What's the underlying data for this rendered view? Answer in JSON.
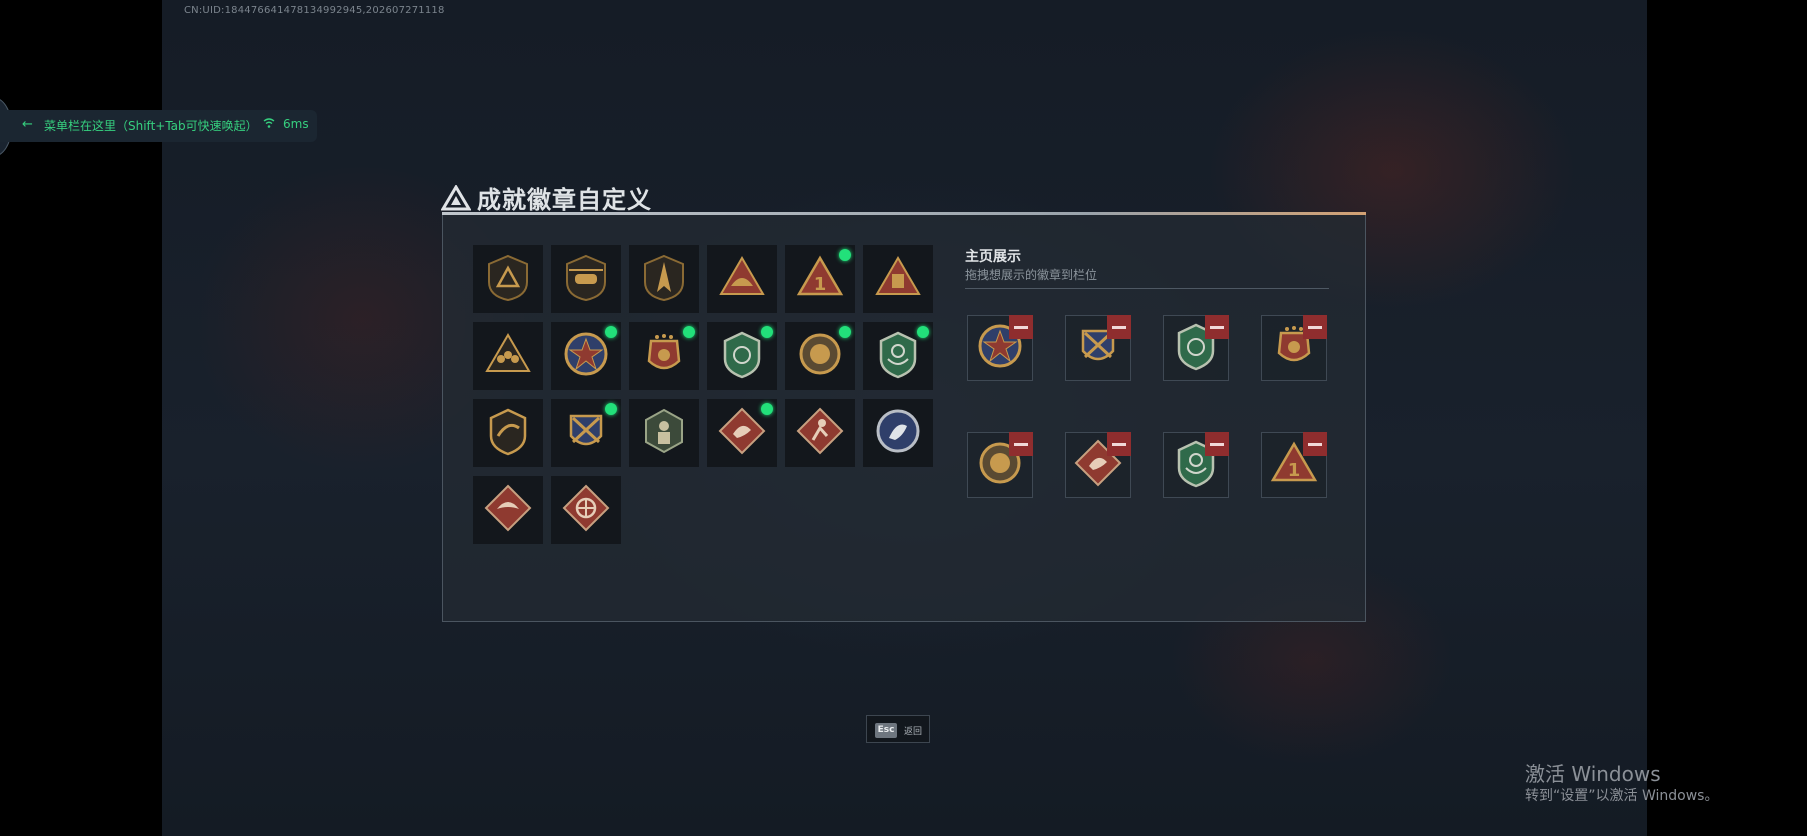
{
  "uid_text": "CN:UID:1844766414781349​92945,202607271118",
  "menu_bar": {
    "hint": "菜单栏在这里（Shift+Tab可快速唤起）",
    "latency": "6ms",
    "status_color": "#36d07f"
  },
  "page": {
    "title": "成就徽章自定义"
  },
  "badges": [
    {
      "icon": "triangle-emblem-badge-icon",
      "new": false
    },
    {
      "icon": "helicopter-badge-icon",
      "new": false
    },
    {
      "icon": "arrowhead-badge-icon",
      "new": false
    },
    {
      "icon": "tent-badge-icon",
      "new": false
    },
    {
      "icon": "number-one-badge-icon",
      "new": true
    },
    {
      "icon": "supply-badge-icon",
      "new": false
    },
    {
      "icon": "squad-badge-icon",
      "new": false
    },
    {
      "icon": "star-crest-badge-icon",
      "new": true
    },
    {
      "icon": "winged-medal-badge-icon",
      "new": true
    },
    {
      "icon": "green-shield-badge-icon",
      "new": true
    },
    {
      "icon": "round-crest-badge-icon",
      "new": true
    },
    {
      "icon": "green-laurel-badge-icon",
      "new": true
    },
    {
      "icon": "claw-shield-badge-icon",
      "new": false
    },
    {
      "icon": "crossed-rifles-badge-icon",
      "new": true
    },
    {
      "icon": "hexagon-soldier-badge-icon",
      "new": false
    },
    {
      "icon": "dragon-diamond-badge-icon",
      "new": true
    },
    {
      "icon": "runner-diamond-badge-icon",
      "new": false
    },
    {
      "icon": "beast-circle-badge-icon",
      "new": false
    },
    {
      "icon": "eagle-diamond-badge-icon",
      "new": false
    },
    {
      "icon": "wheel-diamond-badge-icon",
      "new": false
    }
  ],
  "showcase": {
    "title": "主页展示",
    "subtitle": "拖拽想展示的徽章到栏位",
    "slots": [
      {
        "icon": "star-crest-badge-icon"
      },
      {
        "icon": "crossed-rifles-badge-icon"
      },
      {
        "icon": "green-shield-badge-icon"
      },
      {
        "icon": "winged-medal-badge-icon"
      },
      {
        "icon": "round-crest-badge-icon"
      },
      {
        "icon": "dragon-diamond-badge-icon"
      },
      {
        "icon": "green-laurel-badge-icon"
      },
      {
        "icon": "number-one-badge-icon"
      }
    ]
  },
  "footer": {
    "esc_key": "Esc",
    "esc_label": "返回"
  },
  "windows_activation": {
    "title": "激活 Windows",
    "subtitle": "转到“设置”以激活 Windows。"
  },
  "colors": {
    "new_dot": "#22e07a",
    "remove": "#8f2d2e",
    "gold": "#c79a4e"
  }
}
